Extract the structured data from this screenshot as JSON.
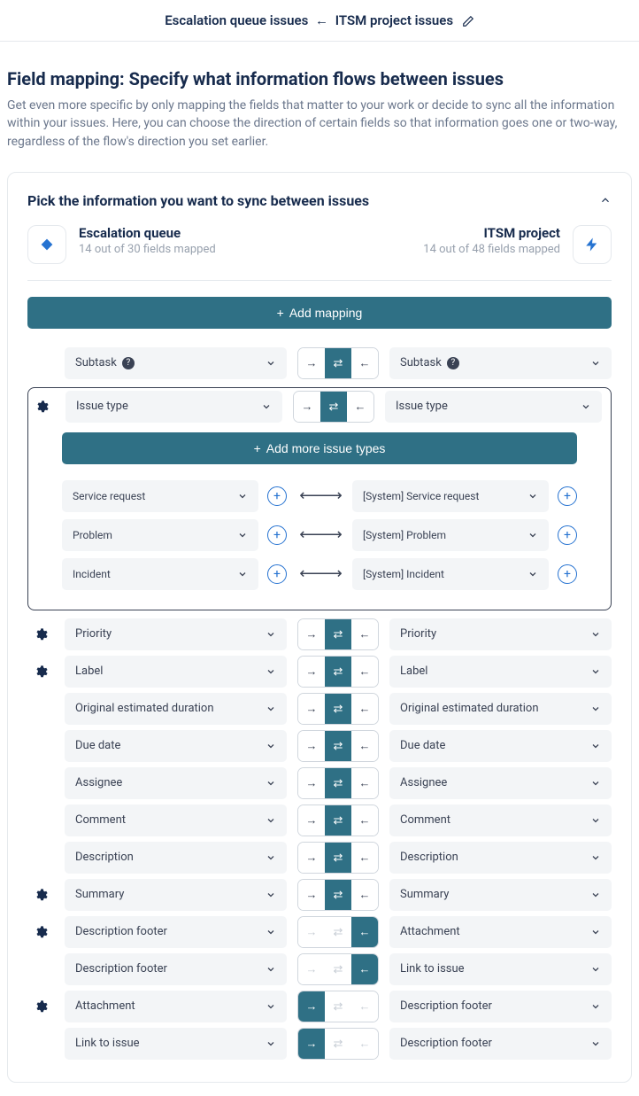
{
  "header": {
    "left": "Escalation queue issues",
    "right": "ITSM project issues"
  },
  "title": "Field mapping: Specify what information flows between issues",
  "description": "Get even more specific by only mapping the fields that matter to your work or decide to sync all the information within your issues. Here, you can choose the direction of certain fields so that information goes one or two-way, regardless of the flow's direction you set earlier.",
  "panel": {
    "title": "Pick the information you want to sync between issues",
    "left": {
      "name": "Escalation queue",
      "sub": "14 out of 30 fields mapped"
    },
    "right": {
      "name": "ITSM project",
      "sub": "14 out of 48 fields mapped"
    },
    "addMapping": "Add mapping",
    "addIssueTypes": "Add more issue types"
  },
  "rows": [
    {
      "gear": false,
      "left": "Subtask",
      "right": "Subtask",
      "help": true,
      "dir": "both"
    },
    {
      "gear": true,
      "left": "Issue type",
      "right": "Issue type",
      "dir": "both",
      "expanded": true,
      "children": [
        {
          "left": "Service request",
          "right": "[System] Service request"
        },
        {
          "left": "Problem",
          "right": "[System] Problem"
        },
        {
          "left": "Incident",
          "right": "[System] Incident"
        }
      ]
    },
    {
      "gear": true,
      "left": "Priority",
      "right": "Priority",
      "dir": "both"
    },
    {
      "gear": true,
      "left": "Label",
      "right": "Label",
      "dir": "both"
    },
    {
      "gear": false,
      "left": "Original estimated duration",
      "right": "Original estimated duration",
      "dir": "both"
    },
    {
      "gear": false,
      "left": "Due date",
      "right": "Due date",
      "dir": "both"
    },
    {
      "gear": false,
      "left": "Assignee",
      "right": "Assignee",
      "dir": "both"
    },
    {
      "gear": false,
      "left": "Comment",
      "right": "Comment",
      "dir": "both"
    },
    {
      "gear": false,
      "left": "Description",
      "right": "Description",
      "dir": "both"
    },
    {
      "gear": true,
      "left": "Summary",
      "right": "Summary",
      "dir": "both"
    },
    {
      "gear": true,
      "left": "Description footer",
      "right": "Attachment",
      "dir": "left"
    },
    {
      "gear": false,
      "left": "Description footer",
      "right": "Link to issue",
      "dir": "left"
    },
    {
      "gear": true,
      "left": "Attachment",
      "right": "Description footer",
      "dir": "right"
    },
    {
      "gear": false,
      "left": "Link to issue",
      "right": "Description footer",
      "dir": "right"
    }
  ]
}
